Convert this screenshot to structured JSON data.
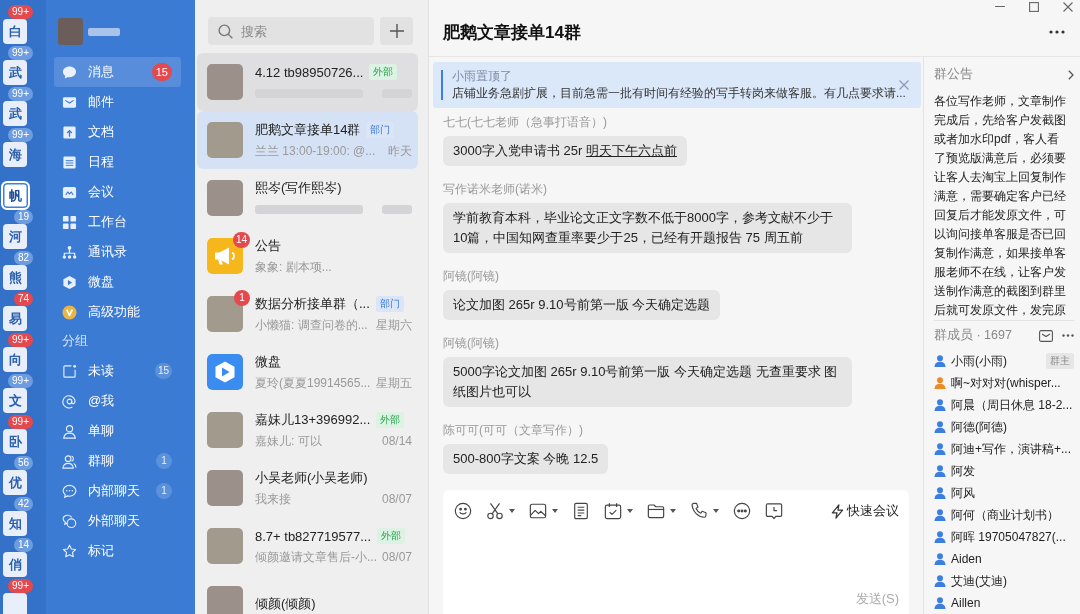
{
  "rail": [
    {
      "label": "白",
      "badge": "99+",
      "alert": true,
      "selected": false
    },
    {
      "label": "武",
      "badge": "99+",
      "alert": false,
      "selected": false
    },
    {
      "label": "武",
      "badge": "99+",
      "alert": false,
      "selected": false
    },
    {
      "label": "海",
      "badge": "99+",
      "alert": false,
      "selected": false
    },
    {
      "label": "帆",
      "selected": true
    },
    {
      "label": "河",
      "badge": "19",
      "alert": false,
      "selected": false
    },
    {
      "label": "熊",
      "badge": "82",
      "alert": false,
      "selected": false
    },
    {
      "label": "易",
      "badge": "74",
      "alert": true,
      "selected": false
    },
    {
      "label": "向",
      "badge": "99+",
      "alert": true,
      "selected": false
    },
    {
      "label": "文",
      "badge": "99+",
      "alert": false,
      "selected": false
    },
    {
      "label": "卧",
      "badge": "99+",
      "alert": true,
      "selected": false
    },
    {
      "label": "优",
      "badge": "56",
      "alert": false,
      "selected": false
    },
    {
      "label": "知",
      "badge": "42",
      "alert": false,
      "selected": false
    },
    {
      "label": "俏",
      "badge": "14",
      "alert": false,
      "selected": false
    },
    {
      "badge": "99+",
      "alert": true,
      "selected": false
    }
  ],
  "sidebar": {
    "items": [
      {
        "label": "消息",
        "badge": "15",
        "selected": true
      },
      {
        "label": "邮件",
        "selected": false
      },
      {
        "label": "文档",
        "selected": false
      },
      {
        "label": "日程",
        "selected": false
      },
      {
        "label": "会议",
        "selected": false
      },
      {
        "label": "工作台",
        "selected": false
      },
      {
        "label": "通讯录",
        "selected": false
      },
      {
        "label": "微盘",
        "selected": false
      },
      {
        "label": "高级功能",
        "selected": false
      }
    ],
    "groups_heading": "分组",
    "groups": [
      {
        "label": "未读",
        "count": "15",
        "selected": false
      },
      {
        "label": "@我",
        "selected": false
      },
      {
        "label": "单聊",
        "selected": false
      },
      {
        "label": "群聊",
        "count": "1",
        "selected": false
      },
      {
        "label": "内部聊天",
        "count": "1",
        "selected": false
      },
      {
        "label": "外部聊天",
        "selected": false
      },
      {
        "label": "标记",
        "selected": false
      }
    ]
  },
  "chat_list": {
    "search": {
      "placeholder": "搜索"
    },
    "items": [
      {
        "kind": "photo",
        "name": "4.12 tb98950726...",
        "tag": {
          "label": "外部",
          "kind": "external"
        },
        "redacted": true,
        "pinned": true,
        "selected": false
      },
      {
        "kind": "group",
        "name": "肥鹅文章接单14群",
        "tag": {
          "label": "部门",
          "kind": "department"
        },
        "preview": "兰兰 13:00-19:00: @...",
        "time": "昨天",
        "pinned": false,
        "selected": true
      },
      {
        "kind": "photo",
        "name": "熙岑(写作熙岑)",
        "redacted": true,
        "pinned": false,
        "selected": false
      },
      {
        "kind": "announcement",
        "name": "公告",
        "badge": "14",
        "preview": "象象: 剧本项...",
        "pinned": false,
        "selected": false
      },
      {
        "kind": "group",
        "name": "数据分析接单群（...",
        "tag": {
          "label": "部门",
          "kind": "department"
        },
        "badge": "1",
        "preview": "小懒猫: 调查问卷的...",
        "time": "星期六",
        "pinned": false,
        "selected": false
      },
      {
        "kind": "drive",
        "name": "微盘",
        "preview": "夏玲(夏夏19914565...",
        "time": "星期五",
        "pinned": false,
        "selected": false
      },
      {
        "kind": "group",
        "name": "嘉妹儿13+396992...",
        "tag": {
          "label": "外部",
          "kind": "external"
        },
        "preview": "嘉妹儿: 可以",
        "time": "08/14",
        "pinned": false,
        "selected": false
      },
      {
        "kind": "photo",
        "name": "小吴老师(小吴老师)",
        "preview": "我来接",
        "time": "08/07",
        "pinned": false,
        "selected": false
      },
      {
        "kind": "group",
        "name": "8.7+ tb827719577...",
        "tag": {
          "label": "外部",
          "kind": "external"
        },
        "preview": "倾颜邀请文章售后-小...",
        "time": "08/07",
        "pinned": false,
        "selected": false
      },
      {
        "kind": "photo",
        "name": "倾颜(倾颜)",
        "pinned": false,
        "selected": false
      }
    ]
  },
  "chat": {
    "title": "肥鹅文章接单14群",
    "pinned": {
      "by": "小雨置顶了",
      "text": "店铺业务急剧扩展，目前急需一批有时间有经验的写手转岗来做客服。有几点要求请..."
    },
    "messages": [
      {
        "sender": "七七(七七老师（急事打语音）)",
        "text": "3000字入党申请书 25r ",
        "link": "明天下午六点前"
      },
      {
        "sender": "写作诺米老师(诺米)",
        "text": "学前教育本科，毕业论文正文字数不低于8000字，参考文献不少于10篇，中国知网查重率要少于25，已经有开题报告 75 周五前"
      },
      {
        "sender": "阿镜(阿镜)",
        "text": "论文加图 265r 9.10号前第一版 今天确定选题"
      },
      {
        "sender": "阿镜(阿镜)",
        "text": "5000字论文加图 265r 9.10号前第一版 今天确定选题 无查重要求 图纸图片也可以"
      },
      {
        "sender": "陈可可(可可（文章写作）)",
        "text": "500-800字文案 今晚 12.5"
      }
    ],
    "composer": {
      "tools": [
        {
          "dropdown": false
        },
        {
          "dropdown": true
        },
        {
          "dropdown": true
        },
        {
          "dropdown": false
        },
        {
          "dropdown": true
        },
        {
          "dropdown": true
        },
        {
          "dropdown": true
        },
        {
          "dropdown": false
        },
        {
          "dropdown": false
        }
      ],
      "quick_meeting": "快速会议",
      "send": "发送(S)"
    }
  },
  "right_panel": {
    "notice": {
      "title": "群公告",
      "text": "各位写作老师，文章制作完成后，先给客户发截图或者加水印pdf，客人看了预览版满意后，必须要让客人去淘宝上回复制作满意，需要确定客户已经回复后才能发原文件，可以询问接单客服是否已回复制作满意，如果接单客服老师不在线，让客户发送制作满意的截图到群里后就可发原文件，发完原"
    },
    "members": {
      "title": "群成员 · 1697",
      "items": [
        {
          "name": "小雨(小雨)",
          "color": "#3d7fe0",
          "role": "群主"
        },
        {
          "name": "啊~对对对(whisper...",
          "color": "#f08a24"
        },
        {
          "name": "阿晨（周日休息 18-2...",
          "color": "#3d7fe0"
        },
        {
          "name": "阿德(阿德)",
          "color": "#3d7fe0"
        },
        {
          "name": "阿迪+写作，演讲稿+...",
          "color": "#3d7fe0"
        },
        {
          "name": "阿发",
          "color": "#3d7fe0"
        },
        {
          "name": "阿风",
          "color": "#3d7fe0"
        },
        {
          "name": "阿何（商业计划书）",
          "color": "#3d7fe0"
        },
        {
          "name": "阿晖 19705047827(...",
          "color": "#3d7fe0"
        },
        {
          "name": "Aiden",
          "color": "#3d7fe0"
        },
        {
          "name": "艾迪(艾迪)",
          "color": "#3d7fe0"
        },
        {
          "name": "Aillen",
          "color": "#3d7fe0"
        }
      ]
    }
  }
}
